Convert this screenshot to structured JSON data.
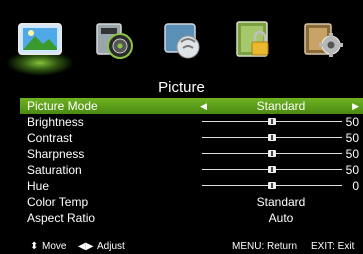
{
  "tabs": [
    {
      "name": "picture",
      "icon": "picture-icon"
    },
    {
      "name": "sound",
      "icon": "sound-icon"
    },
    {
      "name": "channel",
      "icon": "channel-icon"
    },
    {
      "name": "lock",
      "icon": "lock-icon"
    },
    {
      "name": "setup",
      "icon": "setup-icon"
    }
  ],
  "menu": {
    "title": "Picture",
    "picture_mode": {
      "label": "Picture Mode",
      "value": "Standard"
    },
    "brightness": {
      "label": "Brightness",
      "value": "50",
      "level": 0.5
    },
    "contrast": {
      "label": "Contrast",
      "value": "50",
      "level": 0.5
    },
    "sharpness": {
      "label": "Sharpness",
      "value": "50",
      "level": 0.5
    },
    "saturation": {
      "label": "Saturation",
      "value": "50",
      "level": 0.5
    },
    "hue": {
      "label": "Hue",
      "value": "0",
      "level": 0.5
    },
    "color_temp": {
      "label": "Color Temp",
      "value": "Standard"
    },
    "aspect_ratio": {
      "label": "Aspect Ratio",
      "value": "Auto"
    }
  },
  "footer": {
    "move": "Move",
    "adjust": "Adjust",
    "menu_return": "MENU: Return",
    "exit": "EXIT: Exit"
  },
  "colors": {
    "highlight": "#5a9e1a",
    "background": "#000000"
  }
}
